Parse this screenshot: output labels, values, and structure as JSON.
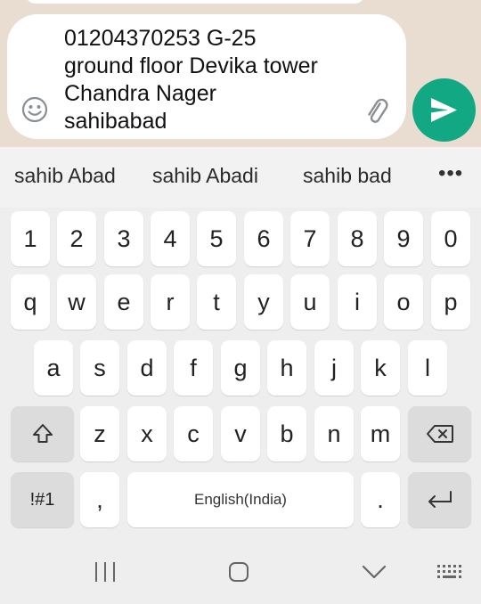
{
  "chat": {
    "message_text": "01204370253 G-25\nground floor Devika tower\nChandra Nager\nsahibabad"
  },
  "suggestions": [
    "sahib Abad",
    "sahib Abadi",
    "sahib bad"
  ],
  "suggestion_more": "•••",
  "keyboard": {
    "numbers": [
      "1",
      "2",
      "3",
      "4",
      "5",
      "6",
      "7",
      "8",
      "9",
      "0"
    ],
    "row1": [
      "q",
      "w",
      "e",
      "r",
      "t",
      "y",
      "u",
      "i",
      "o",
      "p"
    ],
    "row2": [
      "a",
      "s",
      "d",
      "f",
      "g",
      "h",
      "j",
      "k",
      "l"
    ],
    "row3": [
      "z",
      "x",
      "c",
      "v",
      "b",
      "n",
      "m"
    ],
    "symbols_label": "!#1",
    "comma": ",",
    "space_label": "English(India)",
    "period": "."
  },
  "colors": {
    "send_button": "#12a884",
    "chat_background": "#e8ddd0",
    "keyboard_background": "#eeeeee"
  },
  "icons": {
    "emoji": "emoji-icon",
    "attach": "paperclip-icon",
    "send": "send-icon",
    "shift": "shift-icon",
    "backspace": "backspace-icon",
    "enter": "enter-icon",
    "nav_recents": "recents-icon",
    "nav_home": "home-icon",
    "nav_back": "back-chevron-icon",
    "nav_keyboard": "keyboard-icon"
  }
}
